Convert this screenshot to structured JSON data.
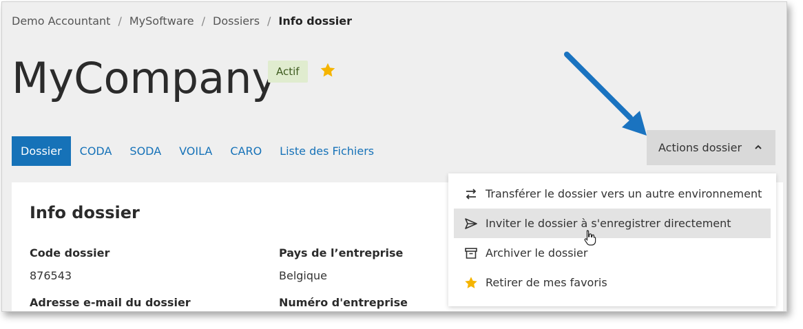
{
  "breadcrumb": {
    "items": [
      "Demo Accountant",
      "MySoftware",
      "Dossiers"
    ],
    "current": "Info dossier",
    "separator": "/"
  },
  "header": {
    "company_name": "MyCompany",
    "status_badge": "Actif",
    "favorite_icon": "star-icon",
    "favorite_color": "#f5b400"
  },
  "tabs": [
    {
      "label": "Dossier",
      "active": true
    },
    {
      "label": "CODA",
      "active": false
    },
    {
      "label": "SODA",
      "active": false
    },
    {
      "label": "VOILA",
      "active": false
    },
    {
      "label": "CARO",
      "active": false
    },
    {
      "label": "Liste des Fichiers",
      "active": false
    }
  ],
  "actions": {
    "button_label": "Actions dossier",
    "icon": "chevron-up-icon",
    "menu": [
      {
        "icon": "transfer-icon",
        "label": "Transférer le dossier vers un autre environnement"
      },
      {
        "icon": "send-icon",
        "label": "Inviter le dossier à s'enregistrer directement"
      },
      {
        "icon": "archive-icon",
        "label": "Archiver le dossier"
      },
      {
        "icon": "star-icon",
        "label": "Retirer de mes favoris"
      }
    ]
  },
  "info": {
    "title": "Info dossier",
    "fields": {
      "code_label": "Code dossier",
      "code_value": "876543",
      "country_label": "Pays de l’entreprise",
      "country_value": "Belgique",
      "email_label": "Adresse e-mail du dossier",
      "company_number_label": "Numéro d'entreprise"
    }
  },
  "colors": {
    "accent": "#1672b8",
    "annotation_arrow": "#1a73c0",
    "badge_bg": "#e0eccf"
  }
}
